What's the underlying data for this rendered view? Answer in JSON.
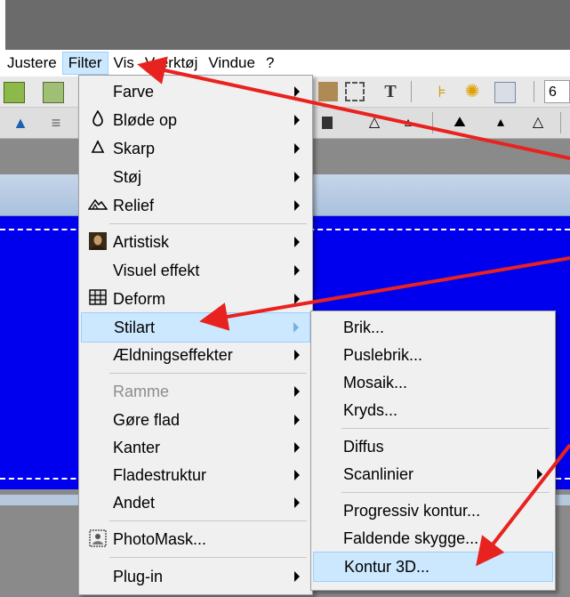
{
  "menubar": {
    "items": [
      "Justere",
      "Filter",
      "Vis",
      "Værktøj",
      "Vindue",
      "?"
    ]
  },
  "toolbar": {
    "zoom_partial": "6"
  },
  "filter_menu": {
    "items": [
      {
        "label": "Farve",
        "submenu": true,
        "icon": ""
      },
      {
        "label": "Bløde op",
        "submenu": true,
        "icon": "droplet-outline-icon"
      },
      {
        "label": "Skarp",
        "submenu": true,
        "icon": "triangle-outline-icon"
      },
      {
        "label": "Støj",
        "submenu": true,
        "icon": ""
      },
      {
        "label": "Relief",
        "submenu": true,
        "icon": "relief-icon"
      },
      {
        "label": "Artistisk",
        "submenu": true,
        "icon": "portrait-icon"
      },
      {
        "label": "Visuel effekt",
        "submenu": true,
        "icon": ""
      },
      {
        "label": "Deform",
        "submenu": true,
        "icon": "grid-icon"
      },
      {
        "label": "Stilart",
        "submenu": true,
        "icon": "",
        "highlighted": true
      },
      {
        "label": "Ældningseffekter",
        "submenu": true,
        "icon": ""
      },
      {
        "label": "Ramme",
        "submenu": true,
        "icon": "",
        "disabled": true
      },
      {
        "label": "Gøre flad",
        "submenu": true,
        "icon": ""
      },
      {
        "label": "Kanter",
        "submenu": true,
        "icon": ""
      },
      {
        "label": "Fladestruktur",
        "submenu": true,
        "icon": ""
      },
      {
        "label": "Andet",
        "submenu": true,
        "icon": ""
      },
      {
        "label": "PhotoMask...",
        "submenu": false,
        "icon": "photomask-icon"
      },
      {
        "label": "Plug-in",
        "submenu": true,
        "icon": ""
      }
    ]
  },
  "stilart_submenu": {
    "items": [
      {
        "label": "Brik..."
      },
      {
        "label": "Puslebrik..."
      },
      {
        "label": "Mosaik..."
      },
      {
        "label": "Kryds..."
      },
      {
        "label": "Diffus"
      },
      {
        "label": "Scanlinier",
        "submenu": true
      },
      {
        "label": "Progressiv kontur..."
      },
      {
        "label": "Faldende skygge..."
      },
      {
        "label": "Kontur 3D...",
        "highlighted": true
      }
    ]
  },
  "colors": {
    "canvas_blue": "#0000ee",
    "highlight": "#cce8ff",
    "arrow_red": "#e8231f"
  }
}
